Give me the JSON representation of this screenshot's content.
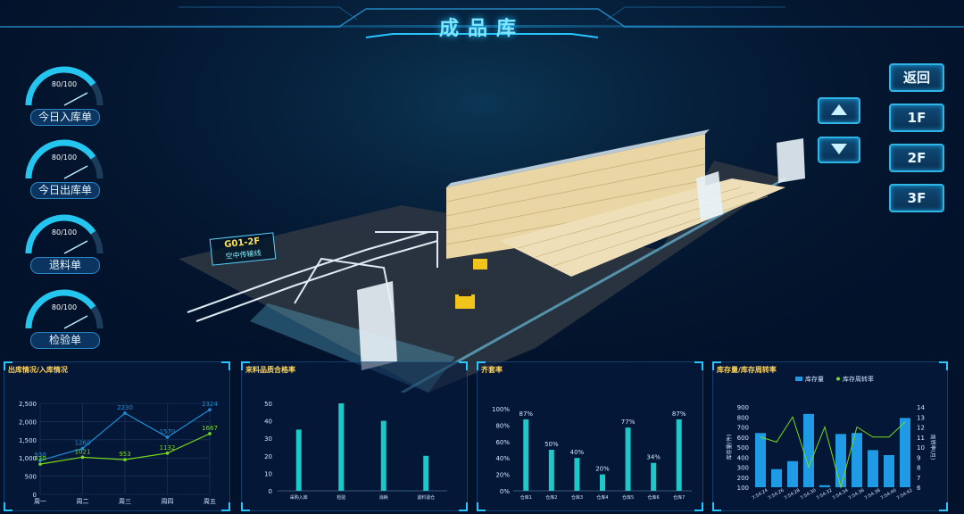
{
  "header": {
    "title": "成品库"
  },
  "gauges": [
    {
      "value_text": "80/100",
      "label": "今日入库单",
      "value": 80,
      "max": 100
    },
    {
      "value_text": "80/100",
      "label": "今日出库单",
      "value": 80,
      "max": 100
    },
    {
      "value_text": "80/100",
      "label": "退料单",
      "value": 80,
      "max": 100
    },
    {
      "value_text": "80/100",
      "label": "检验单",
      "value": 80,
      "max": 100
    }
  ],
  "nav": {
    "back_label": "返回",
    "floor1": "1F",
    "floor2": "2F",
    "floor3": "3F",
    "up_icon": "triangle-up-icon",
    "down_icon": "triangle-down-icon"
  },
  "scene": {
    "line_code": "G01-2F",
    "line_name": "空中传输线"
  },
  "colors": {
    "accent": "#27c6ff",
    "title": "#7fe6ff",
    "bar": "#1ec8c8",
    "panel_title": "#ffd45a",
    "series_blue": "#1f8fd8",
    "series_green": "#7bd91b"
  },
  "panels": [
    {
      "title": "出库情况/入库情况"
    },
    {
      "title": "来料品质合格率"
    },
    {
      "title": "齐套率"
    },
    {
      "title": "库存量/库存周转率"
    }
  ],
  "chart_data": [
    {
      "type": "line",
      "title": "出库情况/入库情况",
      "categories": [
        "周一",
        "周二",
        "周三",
        "周四",
        "周五"
      ],
      "series": [
        {
          "name": "",
          "values": [
            930,
            1260,
            2230,
            1570,
            2324
          ],
          "color": "#1f8fd8"
        },
        {
          "name": "",
          "values": [
            830,
            1021,
            953,
            1132,
            1667
          ],
          "color": "#7bd91b"
        }
      ],
      "ylim": [
        0,
        2500
      ],
      "yticks": [
        0,
        500,
        "1,000",
        "1,500",
        "2,000",
        "2,500"
      ],
      "grid": true
    },
    {
      "type": "bar",
      "title": "来料品质合格率",
      "categories": [
        "采购入库",
        "检验",
        "消耗",
        "退料退仓"
      ],
      "values": [
        35,
        50,
        40,
        20
      ],
      "ylim": [
        0,
        50
      ],
      "yticks": [
        0,
        10,
        20,
        30,
        40,
        50
      ]
    },
    {
      "type": "bar",
      "title": "齐套率",
      "categories": [
        "仓库1",
        "仓库2",
        "仓库3",
        "仓库4",
        "仓库5",
        "仓库6",
        "仓库7"
      ],
      "values": [
        87,
        50,
        40,
        20,
        77,
        34,
        87
      ],
      "data_labels": [
        "87%",
        "50%",
        "40%",
        "20%",
        "77%",
        "34%",
        "87%"
      ],
      "ylim": [
        0,
        100
      ],
      "yticks": [
        "0%",
        "20%",
        "40%",
        "60%",
        "80%",
        "100%"
      ]
    },
    {
      "type": "bar",
      "title": "库存量/库存周转率",
      "legend": [
        "库存量",
        "库存周转率"
      ],
      "legend_position": "top",
      "ylabel": "库存量(件)",
      "y2label": "周转率(月)",
      "categories": [
        "7:54:24",
        "7:54:26",
        "7:54:28",
        "7:54:30",
        "7:54:32",
        "7:54:34",
        "7:54:36",
        "7:54:38",
        "7:54:40",
        "7:54:42"
      ],
      "series": [
        {
          "name": "库存量",
          "type": "bar",
          "values": [
            640,
            280,
            360,
            830,
            120,
            630,
            640,
            470,
            420,
            790
          ]
        },
        {
          "name": "库存周转率",
          "type": "line",
          "values": [
            11,
            10.5,
            13,
            8,
            12,
            6,
            12,
            11,
            11,
            12.5
          ]
        }
      ],
      "ylim": [
        100,
        900
      ],
      "yticks": [
        100,
        200,
        300,
        400,
        500,
        600,
        700,
        800,
        900
      ],
      "y2lim": [
        6,
        14
      ],
      "y2ticks": [
        6,
        7,
        8,
        9,
        10,
        11,
        12,
        13,
        14
      ]
    }
  ]
}
